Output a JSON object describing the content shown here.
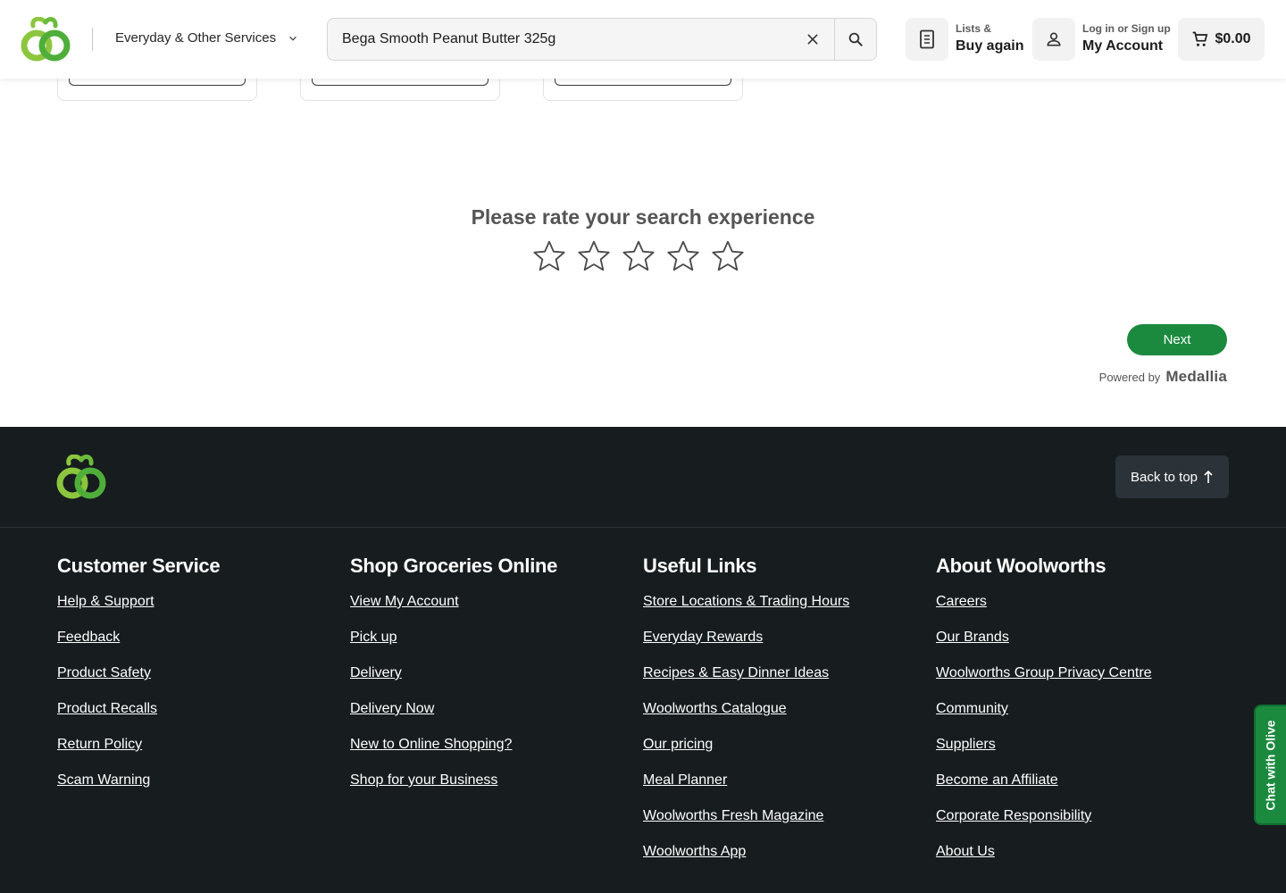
{
  "header": {
    "services_label": "Everyday & Other Services",
    "search_value": "Bega Smooth Peanut Butter 325g",
    "lists_small": "Lists &",
    "lists_big": "Buy again",
    "account_small": "Log in or Sign up",
    "account_big": "My Account",
    "cart_total": "$0.00"
  },
  "survey": {
    "title": "Please rate your search experience",
    "stars_selected": 0,
    "star_count": 5,
    "next_label": "Next",
    "powered_by": "Powered by",
    "brand": "Medallia"
  },
  "footer": {
    "back_to_top": "Back to top",
    "columns": [
      {
        "heading": "Customer Service",
        "links": [
          "Help & Support",
          "Feedback",
          "Product Safety",
          "Product Recalls",
          "Return Policy",
          "Scam Warning"
        ]
      },
      {
        "heading": "Shop Groceries Online",
        "links": [
          "View My Account",
          "Pick up",
          "Delivery",
          "Delivery Now",
          "New to Online Shopping?",
          "Shop for your Business"
        ]
      },
      {
        "heading": "Useful Links",
        "links": [
          "Store Locations & Trading Hours",
          "Everyday Rewards",
          "Recipes & Easy Dinner Ideas",
          "Woolworths Catalogue",
          "Our pricing",
          "Meal Planner",
          "Woolworths Fresh Magazine",
          "Woolworths App"
        ]
      },
      {
        "heading": "About Woolworths",
        "links": [
          "Careers",
          "Our Brands",
          "Woolworths Group Privacy Centre",
          "Community",
          "Suppliers",
          "Become an Affiliate",
          "Corporate Responsibility",
          "About Us"
        ]
      }
    ]
  },
  "chat_label": "Chat with Olive",
  "colors": {
    "brand_green": "#1b8a3f",
    "logo_light_green": "#8cc63e",
    "footer_bg": "#171c1f"
  }
}
